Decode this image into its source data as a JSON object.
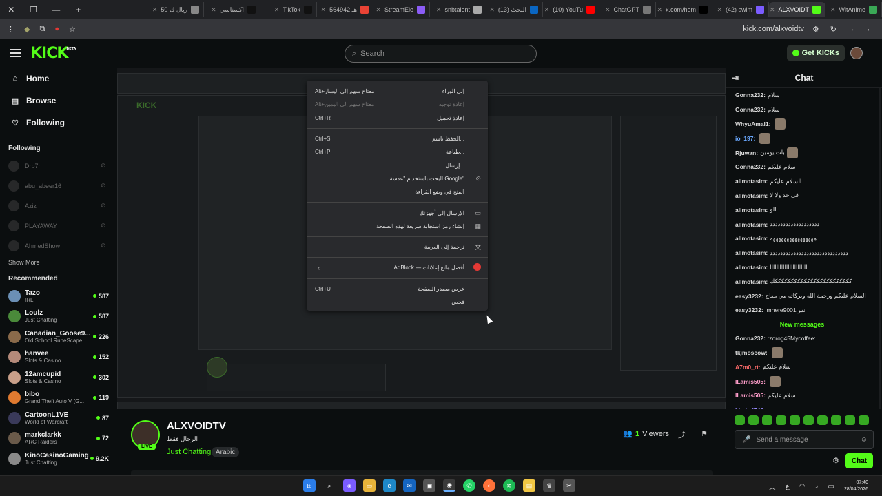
{
  "browser": {
    "tabs": [
      {
        "title": "WitAnime",
        "favicon_color": "#3aa856",
        "active": false
      },
      {
        "title": "ALXVOIDT",
        "favicon_color": "#53fc18",
        "active": true
      },
      {
        "title": "(42) swim",
        "favicon_color": "#7b5cff",
        "active": false
      },
      {
        "title": "x.com/hom",
        "favicon_color": "#000000",
        "active": false
      },
      {
        "title": "ChatGPT",
        "favicon_color": "#777777",
        "active": false
      },
      {
        "title": "(10) YouTu",
        "favicon_color": "#ff0000",
        "active": false
      },
      {
        "title": "(13) البحث",
        "favicon_color": "#0a66c2",
        "active": false
      },
      {
        "title": "snbtalent",
        "favicon_color": "#aaaaaa",
        "active": false
      },
      {
        "title": "StreamEle",
        "favicon_color": "#8b5cf6",
        "active": false
      },
      {
        "title": "564942 هـ",
        "favicon_color": "#ea4335",
        "active": false
      },
      {
        "title": "TikTok",
        "favicon_color": "#111111",
        "active": false
      },
      {
        "title": "اكسناسي",
        "favicon_color": "#111111",
        "active": false
      },
      {
        "title": "50 ريال ك",
        "favicon_color": "#888888",
        "active": false
      }
    ],
    "url": "kick.com/alxvoidtv"
  },
  "header": {
    "logo": "KICK",
    "logo_badge": "BETA",
    "search_placeholder": "Search",
    "get_kicks_label": "Get KICKs"
  },
  "sidebar": {
    "nav": [
      {
        "label": "Home",
        "icon": "home-icon"
      },
      {
        "label": "Browse",
        "icon": "browse-icon"
      },
      {
        "label": "Following",
        "icon": "heart-icon"
      }
    ],
    "following_title": "Following",
    "following": [
      "Drb7h",
      "abu_abeer16",
      "Aziz",
      "PLAYAWAY",
      "AhmedShow"
    ],
    "show_more": "Show More",
    "recommended_title": "Recommended",
    "recommended": [
      {
        "name": "Tazo",
        "category": "IRL",
        "viewers": "587",
        "color": "#6b8fb5"
      },
      {
        "name": "Loulz",
        "category": "Just Chatting",
        "viewers": "587",
        "color": "#4a8a3a"
      },
      {
        "name": "Canadian_Goose9...",
        "category": "Old School RuneScape",
        "viewers": "226",
        "color": "#8a6a4a"
      },
      {
        "name": "hanvee",
        "category": "Slots & Casino",
        "viewers": "152",
        "color": "#b58a7a"
      },
      {
        "name": "12amcupid",
        "category": "Slots & Casino",
        "viewers": "302",
        "color": "#c9a08a"
      },
      {
        "name": "bibo",
        "category": "Grand Theft Auto V (G...",
        "viewers": "119",
        "color": "#e07a30"
      },
      {
        "name": "CartoonL1VE",
        "category": "World of Warcraft",
        "viewers": "87",
        "color": "#3a3a5a"
      },
      {
        "name": "markclarkk",
        "category": "ARC Raiders",
        "viewers": "72",
        "color": "#6a5a4a"
      },
      {
        "name": "KinoCasinoGaming",
        "category": "Just Chatting",
        "viewers": "9.2K",
        "color": "#8a8a8a"
      }
    ]
  },
  "context_menu": [
    {
      "label": "إلى الوراء",
      "shortcut": "Alt+مفتاح سهم إلى اليسار",
      "disabled": false
    },
    {
      "label": "إعادة توجيه",
      "shortcut": "Alt+مفتاح سهم إلى اليمين",
      "disabled": true
    },
    {
      "label": "إعادة تحميل",
      "shortcut": "Ctrl+R",
      "disabled": false
    },
    {
      "label": "الحفظ باسم...",
      "shortcut": "Ctrl+S",
      "disabled": false
    },
    {
      "label": "طباعة...",
      "shortcut": "Ctrl+P",
      "disabled": false
    },
    {
      "label": "إرسال...",
      "shortcut": "",
      "disabled": false
    },
    {
      "label": "البحث باستخدام \"عدسة Google\"",
      "shortcut": "",
      "icon": "lens-icon"
    },
    {
      "label": "الفتح في وضع القراءة",
      "shortcut": ""
    },
    {
      "label": "الإرسال إلى أجهزتك",
      "shortcut": "",
      "icon": "devices-icon"
    },
    {
      "label": "إنشاء رمز استجابة سريعة لهذه الصفحة",
      "shortcut": "",
      "icon": "qr-icon"
    },
    {
      "label": "ترجمة إلى العربية",
      "shortcut": "",
      "icon": "translate-icon"
    },
    {
      "label": "AdBlock — أفضل مانع إعلانات",
      "shortcut": "",
      "icon": "adblock-icon"
    },
    {
      "label": "عرض مصدر الصفحة",
      "shortcut": "Ctrl+U"
    },
    {
      "label": "فحص",
      "shortcut": ""
    }
  ],
  "stream": {
    "name": "ALXVOIDTV",
    "title": "الرجال فقط",
    "category": "Just Chatting",
    "language": "Arabic",
    "live_label": "LIVE",
    "viewers_count": "1",
    "viewers_label": "Viewers"
  },
  "chat": {
    "title": "Chat",
    "messages_before": [
      {
        "user": "Gonna232:",
        "text": "سلام",
        "color": "#d9d9d9"
      },
      {
        "user": "Gonna232:",
        "text": "سلام",
        "color": "#d9d9d9"
      },
      {
        "user": "WhyuAmal1:",
        "text": "",
        "color": "#d9d9d9",
        "emote": true
      },
      {
        "user": "io_197:",
        "text": "",
        "color": "#6aa8ff",
        "emote": true
      },
      {
        "user": "Rjuwan:",
        "text": "بات يومين",
        "color": "#d9d9d9",
        "emote": true
      },
      {
        "user": "Gonna232:",
        "text": "سلام عليكم",
        "color": "#d9d9d9"
      },
      {
        "user": "allmotasim:",
        "text": "السلام عليكم",
        "color": "#d9d9d9"
      },
      {
        "user": "allmotasim:",
        "text": "في حد ولا لا",
        "color": "#d9d9d9"
      },
      {
        "user": "allmotasim:",
        "text": "الو",
        "color": "#d9d9d9"
      },
      {
        "user": "allmotasim:",
        "text": "ددددددددددددددددددد",
        "color": "#d9d9d9"
      },
      {
        "user": "allmotasim:",
        "text": "ههههههههههههههههه",
        "color": "#d9d9d9"
      },
      {
        "user": "allmotasim:",
        "text": "دددددددددددددددددددددددددددددد",
        "color": "#d9d9d9"
      },
      {
        "user": "allmotasim:",
        "text": "ااااااااااااااااااااااا",
        "color": "#d9d9d9"
      },
      {
        "user": "allmotasim:",
        "text": "ككككككككككككككككككككككككك",
        "color": "#d9d9d9"
      },
      {
        "user": "easy3232:",
        "text": "السلام عليكم ورحمة الله وبركاته مي معاج",
        "color": "#d9d9d9"
      },
      {
        "user": "easy3232:",
        "text": "imhere9001نس",
        "color": "#d9d9d9"
      }
    ],
    "new_messages_label": "New messages",
    "messages_after": [
      {
        "user": "Gonna232:",
        "text": ":zorog45Mycoffee:",
        "color": "#d9d9d9"
      },
      {
        "user": "tkjmoscow:",
        "text": "",
        "color": "#d9d9d9",
        "emote": true
      },
      {
        "user": "A7m0_rt:",
        "text": "سلام عليكم",
        "color": "#ff6b6b"
      },
      {
        "user": "ILamis505:",
        "text": "",
        "color": "#ff9ecb",
        "emote": true
      },
      {
        "user": "ILamis505:",
        "text": "سلام عليكم",
        "color": "#ff9ecb"
      },
      {
        "user": "khaled748:",
        "text": "هو",
        "color": "#9a8cff"
      }
    ],
    "input_placeholder": "Send a message",
    "send_label": "Chat"
  },
  "taskbar": {
    "time": "07:40",
    "date": "28/04/2026",
    "lang": "ع"
  }
}
